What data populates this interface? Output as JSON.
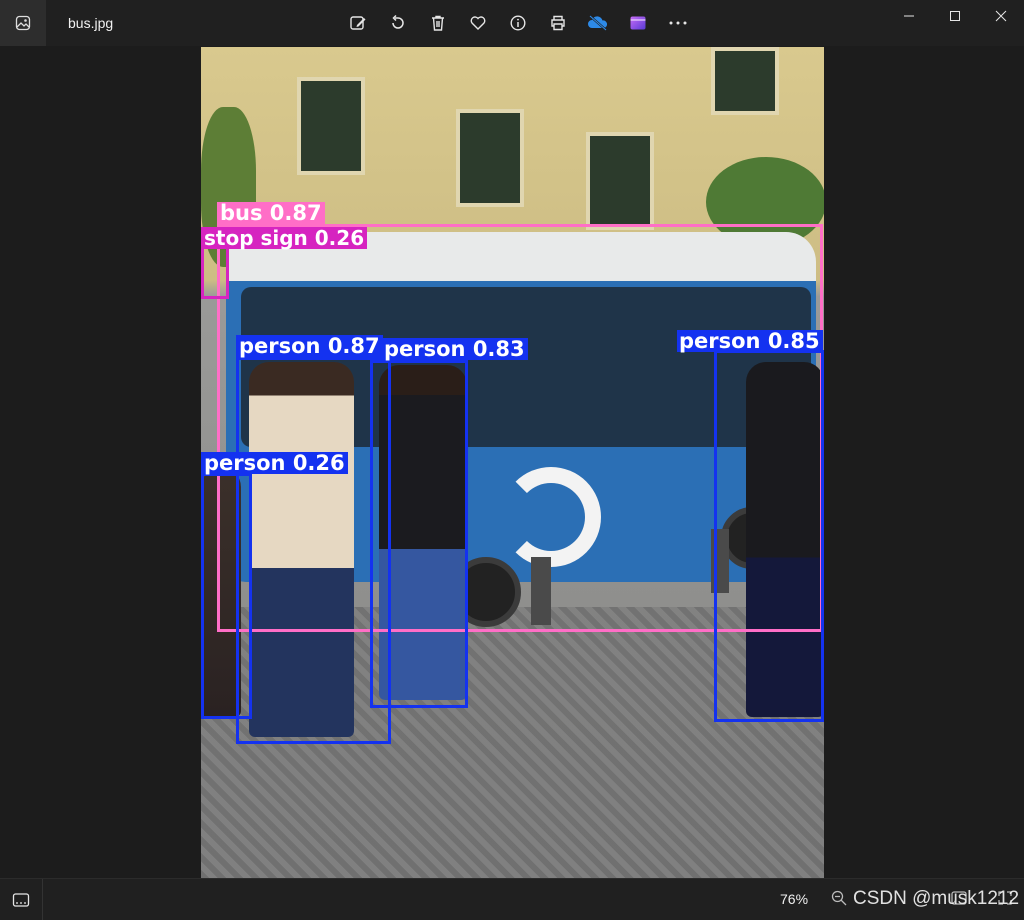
{
  "titlebar": {
    "filename": "bus.jpg",
    "toolbar": [
      {
        "icon": "edit-image-icon"
      },
      {
        "icon": "rotate-icon"
      },
      {
        "icon": "delete-icon"
      },
      {
        "icon": "favorite-heart-icon"
      },
      {
        "icon": "info-icon"
      },
      {
        "icon": "print-icon"
      },
      {
        "icon": "onedrive-cloud-icon"
      },
      {
        "icon": "clipchamp-icon"
      },
      {
        "icon": "more-icon"
      }
    ],
    "window_controls": [
      "minimize-icon",
      "maximize-icon",
      "close-icon"
    ]
  },
  "detections": [
    {
      "label": "bus 0.87",
      "color": "#ff6ec7"
    },
    {
      "label": "stop sign 0.26",
      "color": "#d624c0"
    },
    {
      "label": "person 0.87",
      "color": "#1432f0"
    },
    {
      "label": "person 0.83",
      "color": "#1432f0"
    },
    {
      "label": "person 0.85",
      "color": "#1432f0"
    },
    {
      "label": "person 0.26",
      "color": "#1432f0"
    }
  ],
  "statusbar": {
    "zoom": "76%",
    "watermark": "CSDN @musk1212"
  }
}
